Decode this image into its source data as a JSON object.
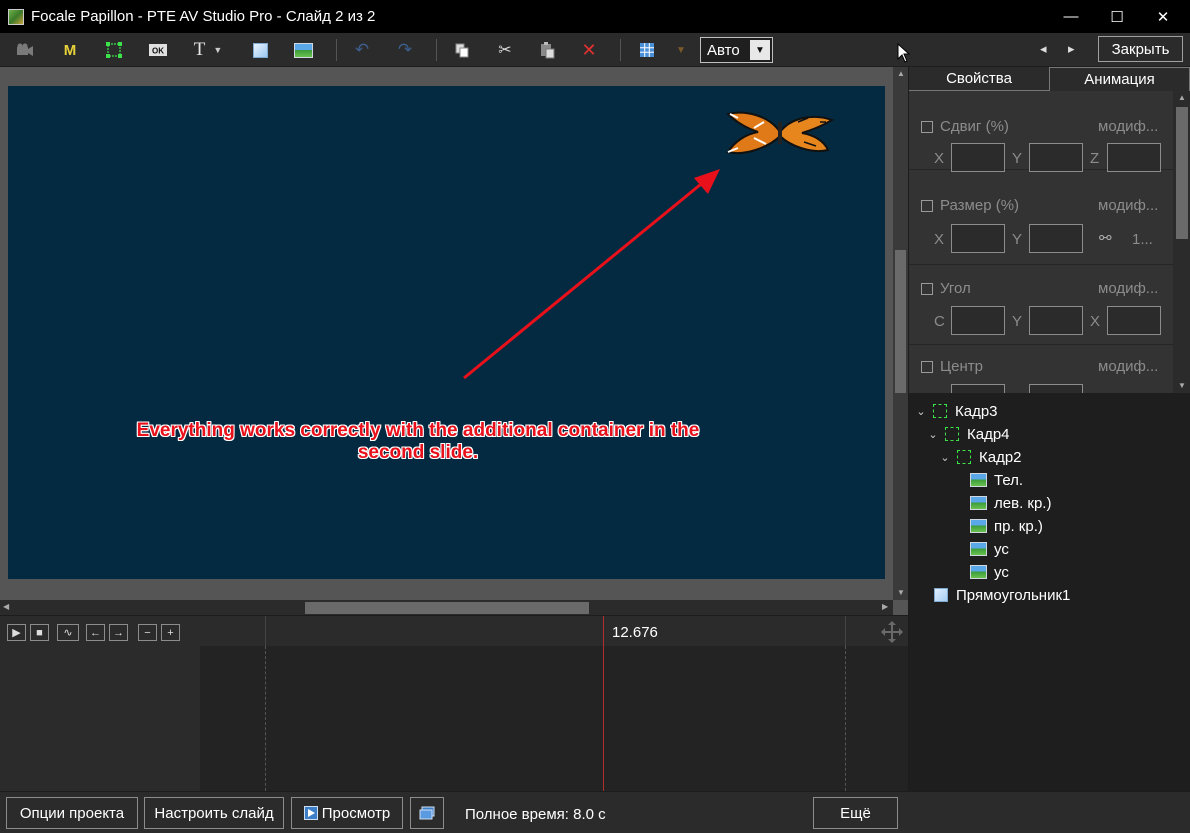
{
  "window": {
    "title": "Focale Papillon - PTE AV Studio Pro - Слайд 2 из 2",
    "minimize": "—",
    "maximize": "☐",
    "close": "✕"
  },
  "toolbar": {
    "tools": [
      {
        "name": "camera-icon",
        "glyph": "🎥"
      },
      {
        "name": "mask-icon",
        "glyph": "M"
      },
      {
        "name": "frame-icon",
        "glyph": "⬚"
      },
      {
        "name": "button-icon",
        "glyph": "OK"
      },
      {
        "name": "text-icon",
        "glyph": "T"
      },
      {
        "name": "rectangle-icon",
        "glyph": ""
      },
      {
        "name": "image-icon",
        "glyph": ""
      }
    ],
    "auto_value": "Авто",
    "close_label": "Закрыть",
    "nav_prev": "◂",
    "nav_next": "▸"
  },
  "canvas": {
    "annotation": "Everything works correctly with the additional container in the second slide.",
    "slide_color": "#032a41",
    "annotation_color": "#e8101a"
  },
  "timeline": {
    "current_time": "12.676",
    "controls": [
      "▶",
      "■",
      "∿",
      "←",
      "→",
      "−",
      "+"
    ]
  },
  "bottom": {
    "project_options": "Опции проекта",
    "customize_slide": "Настроить слайд",
    "preview": "Просмотр",
    "total_time": "Полное время: 8.0 с",
    "more": "Ещё"
  },
  "panel": {
    "tabs": {
      "properties": "Свойства",
      "animation": "Анимация"
    },
    "groups": [
      {
        "label": "Сдвиг (%)",
        "modif": "модиф...",
        "axes": [
          "X",
          "Y",
          "Z"
        ],
        "extra": ""
      },
      {
        "label": "Размер (%)",
        "modif": "модиф...",
        "axes": [
          "X",
          "Y"
        ],
        "extra": "1..."
      },
      {
        "label": "Угол",
        "modif": "модиф...",
        "axes": [
          "C",
          "Y",
          "X"
        ],
        "extra": ""
      },
      {
        "label": "Центр",
        "modif": "модиф...",
        "axes": [],
        "extra": ""
      }
    ]
  },
  "tree": {
    "items": [
      {
        "label": "Кадр3",
        "type": "frame",
        "level": 0,
        "expanded": true
      },
      {
        "label": "Кадр4",
        "type": "frame",
        "level": 1,
        "expanded": true
      },
      {
        "label": "Кадр2",
        "type": "frame",
        "level": 2,
        "expanded": true
      },
      {
        "label": "Тел.",
        "type": "image",
        "level": 3
      },
      {
        "label": "лев. кр.)",
        "type": "image",
        "level": 3
      },
      {
        "label": "пр. кр.)",
        "type": "image",
        "level": 3
      },
      {
        "label": "ус",
        "type": "image",
        "level": 3
      },
      {
        "label": "ус",
        "type": "image",
        "level": 3
      },
      {
        "label": "Прямоугольник1",
        "type": "rect",
        "level": 0
      }
    ]
  }
}
